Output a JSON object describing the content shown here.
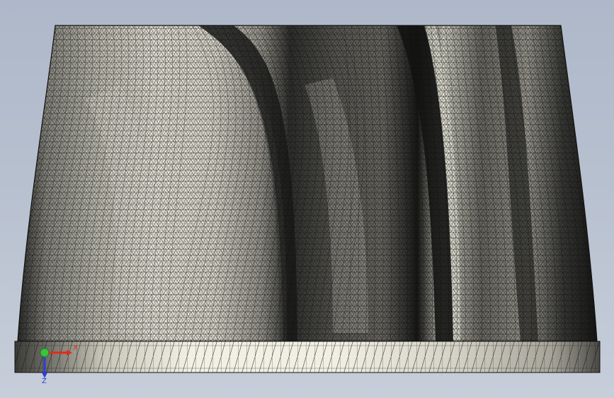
{
  "viewport": {
    "background_top": "#aeb8c9",
    "background_bottom": "#c7ceda",
    "mesh_line_color": "#111111",
    "surface_light": "#f1efe2",
    "surface_mid": "#8f8e86",
    "surface_dark": "#1c1c1b"
  },
  "triad": {
    "x_label": "X",
    "z_label": "Z",
    "x_color": "#e02a1f",
    "y_color": "#3cc23c",
    "z_color": "#2a3fd8",
    "icon": "coordinate-triad-icon"
  }
}
